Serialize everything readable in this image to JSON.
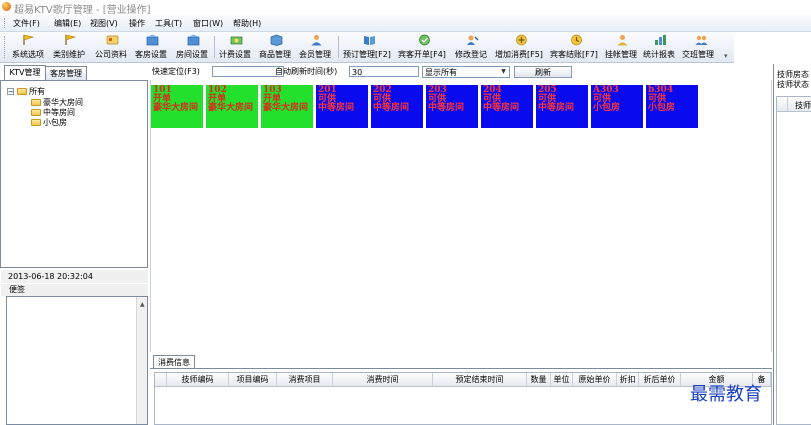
{
  "window": {
    "title": "超易KTV歌厅管理 - [营业操作]"
  },
  "menu": [
    "文件(F)",
    "编辑(E)",
    "视图(V)",
    "操作",
    "工具(T)",
    "窗口(W)",
    "帮助(H)"
  ],
  "toolbar": [
    {
      "label": "系统选项",
      "icon": "flag-icon",
      "color": "#d9a40f"
    },
    {
      "label": "类别维护",
      "icon": "flag-icon",
      "color": "#d9a40f"
    },
    {
      "label": "公司资料",
      "icon": "card-icon",
      "color": "#e0b53a"
    },
    {
      "label": "客房设置",
      "icon": "room-icon",
      "color": "#3c7fc9"
    },
    {
      "label": "房间设置",
      "icon": "room-icon",
      "color": "#3c7fc9"
    },
    {
      "label": "计费设置",
      "icon": "money-icon",
      "color": "#54b54a"
    },
    {
      "label": "商品管理",
      "icon": "box-icon",
      "color": "#3c7fc9"
    },
    {
      "label": "会员管理",
      "icon": "user-icon",
      "color": "#e08a2e"
    },
    {
      "label": "预订管理[F2]",
      "icon": "book-icon",
      "color": "#2f6fbf"
    },
    {
      "label": "宾客开单[F4]",
      "icon": "open-icon",
      "color": "#5aa846"
    },
    {
      "label": "修改登记",
      "icon": "edit-icon",
      "color": "#3c7fc9"
    },
    {
      "label": "增加消费[F5]",
      "icon": "add-icon",
      "color": "#d9a40f"
    },
    {
      "label": "宾客结账[F7]",
      "icon": "checkout-icon",
      "color": "#e0b53a"
    },
    {
      "label": "挂帐管理",
      "icon": "account-icon",
      "color": "#e08a2e"
    },
    {
      "label": "统计报表",
      "icon": "chart-icon",
      "color": "#3c9a5a"
    },
    {
      "label": "交班管理",
      "icon": "shift-icon",
      "color": "#5a7fc9"
    }
  ],
  "tabs": [
    "KTV管理",
    "客房管理"
  ],
  "filter": {
    "quick_locate_label": "快速定位(F3)",
    "quick_locate_value": "",
    "refresh_time_label": "自动刷新时间(秒)",
    "refresh_time_value": "30",
    "display_value": "显示所有",
    "refresh_button": "刷新"
  },
  "tree": {
    "root": "所有",
    "children": [
      "豪华大房间",
      "中等房间",
      "小包房"
    ]
  },
  "datetime": "2013-06-18 20:32:04",
  "memo_label": "便签",
  "rooms": [
    {
      "number": "101",
      "status": "开单",
      "type": "豪华大房间",
      "color": "green"
    },
    {
      "number": "102",
      "status": "开单",
      "type": "豪华大房间",
      "color": "green"
    },
    {
      "number": "103",
      "status": "开单",
      "type": "豪华大房间",
      "color": "green"
    },
    {
      "number": "201",
      "status": "可供",
      "type": "中等房间",
      "color": "blue"
    },
    {
      "number": "202",
      "status": "可供",
      "type": "中等房间",
      "color": "blue"
    },
    {
      "number": "203",
      "status": "可供",
      "type": "中等房间",
      "color": "blue"
    },
    {
      "number": "204",
      "status": "可供",
      "type": "中等房间",
      "color": "blue"
    },
    {
      "number": "205",
      "status": "可供",
      "type": "中等房间",
      "color": "blue"
    },
    {
      "number": "A303",
      "status": "可供",
      "type": "小包房",
      "color": "blue"
    },
    {
      "number": "b304",
      "status": "可供",
      "type": "小包房",
      "color": "blue"
    }
  ],
  "consumption": {
    "tab": "消费信息",
    "columns": [
      "技师编码",
      "项目编码",
      "消费项目",
      "消费时间",
      "预定结束时间",
      "数量",
      "单位",
      "原始单价",
      "折扣",
      "折后单价",
      "金额",
      "备"
    ]
  },
  "right_panel": {
    "line1": "技师房态",
    "line2": "技师状态",
    "column": "技师"
  },
  "watermark": "最需教育"
}
